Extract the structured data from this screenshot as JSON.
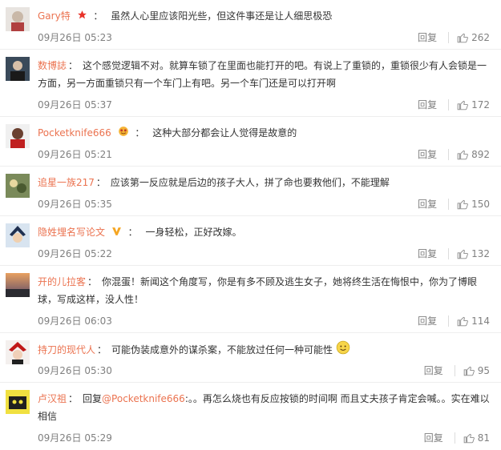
{
  "comments": [
    {
      "user": "Gary特",
      "text": "虽然人心里应该阳光些，但这件事还是让人细思极恐",
      "time": "09月26日 05:23",
      "reply": "回复",
      "likes": "262"
    },
    {
      "user": "数博誌",
      "text": "这个感觉逻辑不对。就算车锁了在里面也能打开的吧。有说上了重锁的，重锁很少有人会锁是一方面，另一方面重锁只有一个车门上有吧。另一个车门还是可以打开啊",
      "time": "09月26日 05:37",
      "reply": "回复",
      "likes": "172"
    },
    {
      "user": "Pocketknife666",
      "text": "这种大部分都会让人觉得是故意的",
      "time": "09月26日 05:21",
      "reply": "回复",
      "likes": "892"
    },
    {
      "user": "追星一族217",
      "text": "应该第一反应就是后边的孩子大人，拼了命也要救他们，不能理解",
      "time": "09月26日 05:35",
      "reply": "回复",
      "likes": "150"
    },
    {
      "user": "隐姓埋名写论文",
      "text": "一身轻松，正好改嫁。",
      "time": "09月26日 05:22",
      "reply": "回复",
      "likes": "132"
    },
    {
      "user": "开的儿拉客",
      "text": "你混蛋！新闻这个角度写，你是有多不顾及逃生女子，她将终生活在悔恨中，你为了博眼球，写成这样，没人性！",
      "time": "09月26日 06:03",
      "reply": "回复",
      "likes": "114"
    },
    {
      "user": "持刀的现代人",
      "text": "可能伪装成意外的谋杀案，不能放过任何一种可能性",
      "time": "09月26日 05:30",
      "reply": "回复",
      "likes": "95"
    },
    {
      "user": "卢汉祖",
      "text_prefix": "回复",
      "mention": "@Pocketknife666",
      "text": ":。。再怎么烧也有反应按锁的时间啊 而且丈夫孩子肯定会喊。。实在难以相信",
      "time": "09月26日 05:29",
      "reply": "回复",
      "likes": "81"
    }
  ],
  "colors": {
    "username": "#eb7350",
    "text": "#333333",
    "meta": "#808080"
  },
  "icons": {
    "like": "thumb-up-icon",
    "vip_red": "red-star-icon",
    "vip_yellow": "yellow-v-icon",
    "smile": "smile-emoji-icon"
  }
}
